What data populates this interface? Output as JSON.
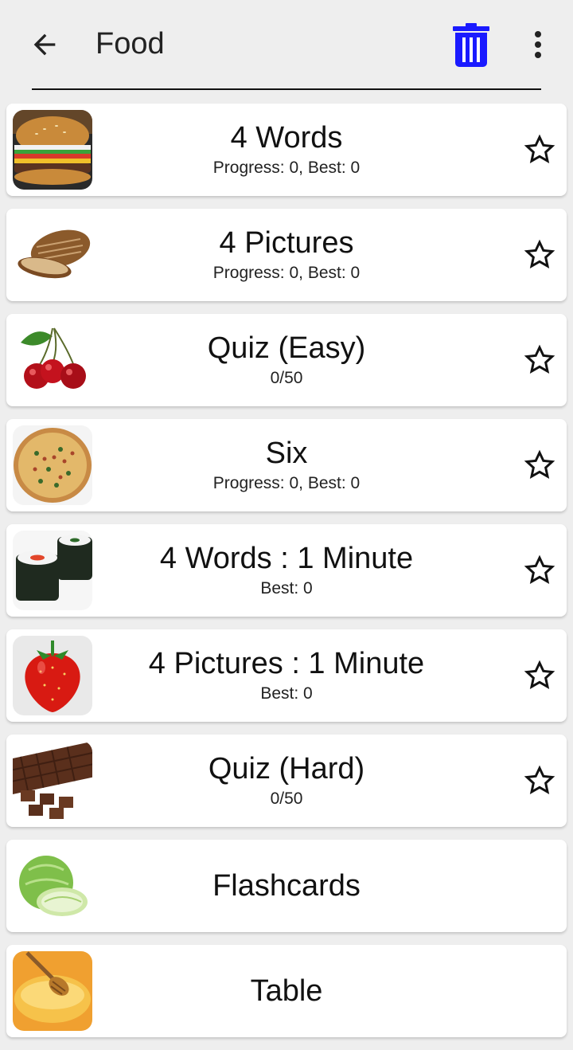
{
  "appbar": {
    "title": "Food",
    "back_icon": "arrow-left-icon",
    "delete_icon": "trash-icon",
    "more_icon": "more-vertical-icon",
    "accent": "#1a1aff"
  },
  "items": [
    {
      "title": "4 Words",
      "subtitle": "Progress: 0, Best: 0",
      "image": "burger-image",
      "starred": false
    },
    {
      "title": "4 Pictures",
      "subtitle": "Progress: 0, Best: 0",
      "image": "bread-image",
      "starred": false
    },
    {
      "title": "Quiz (Easy)",
      "subtitle": "0/50",
      "image": "cherries-image",
      "starred": false
    },
    {
      "title": "Six",
      "subtitle": "Progress: 0, Best: 0",
      "image": "pizza-image",
      "starred": false
    },
    {
      "title": "4 Words : 1 Minute",
      "subtitle": "Best: 0",
      "image": "sushi-image",
      "starred": false
    },
    {
      "title": "4 Pictures : 1 Minute",
      "subtitle": "Best: 0",
      "image": "strawberry-image",
      "starred": false
    },
    {
      "title": "Quiz (Hard)",
      "subtitle": "0/50",
      "image": "chocolate-image",
      "starred": false
    },
    {
      "title": "Flashcards",
      "subtitle": "",
      "image": "cabbage-image"
    },
    {
      "title": "Table",
      "subtitle": "",
      "image": "honey-image"
    }
  ]
}
